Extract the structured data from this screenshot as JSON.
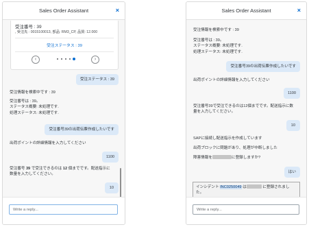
{
  "left_panel": {
    "title": "Sales Order Assistant",
    "close_glyph": "×",
    "card": {
      "order_line": "受注番号 : 39",
      "detail_line": ", 受注先 : 0015100013, 部品: RM3_CP, 品質: 12.000",
      "link": "受注ステータス : 39",
      "prev_glyph": "‹",
      "next_glyph": "›"
    },
    "messages": {
      "u1": "受注ステータス : 39",
      "b1": "受注情報を検索中です : 39",
      "b2": "受注番号は : 39。\nステータス概要: 未処理です.\n処理ステータス: 未処理です.",
      "u2": "受注番号39の出荷伝票作成したいです",
      "b3": "出荷ポイントの詳細情報を入力してください",
      "u3": "1100",
      "b4_pre": "受注番号 ",
      "b4_num1": "39",
      "b4_mid": " で受注できるのは ",
      "b4_num2": "12",
      "b4_post": " 個までです。配送指示に数量を入力してください。",
      "u4": "10"
    },
    "reply_placeholder": "Write a reply..."
  },
  "right_panel": {
    "title": "Sales Order Assistant",
    "close_glyph": "×",
    "messages": {
      "b1": "受注情報を検索中です : 39",
      "b2": "受注番号は : 39。\nステータス概要: 未処理です.\n処理ステータス: 未処理です.",
      "u1": "受注番号39の出荷伝票作成したいです",
      "b3": "出荷ポイントの詳細情報を入力してください",
      "u2": "1100",
      "b4": "受注番号39で受注できるのは12個までです。配送指示に数量を入力してください。",
      "u3": "10",
      "b5": "SAPに接続し配送指示を作成しています",
      "b6": "出荷ブロックに問題があり、処理が中断しました",
      "b7_pre": "障害情報を",
      "b7_post": "に登録しますか?",
      "u4": "はい",
      "b8_pre": "インシデント ",
      "b8_id": "INC0250049",
      "b8_mid": " は",
      "b8_post": " に登録されました。"
    },
    "reply_placeholder": "Write a reply..."
  }
}
